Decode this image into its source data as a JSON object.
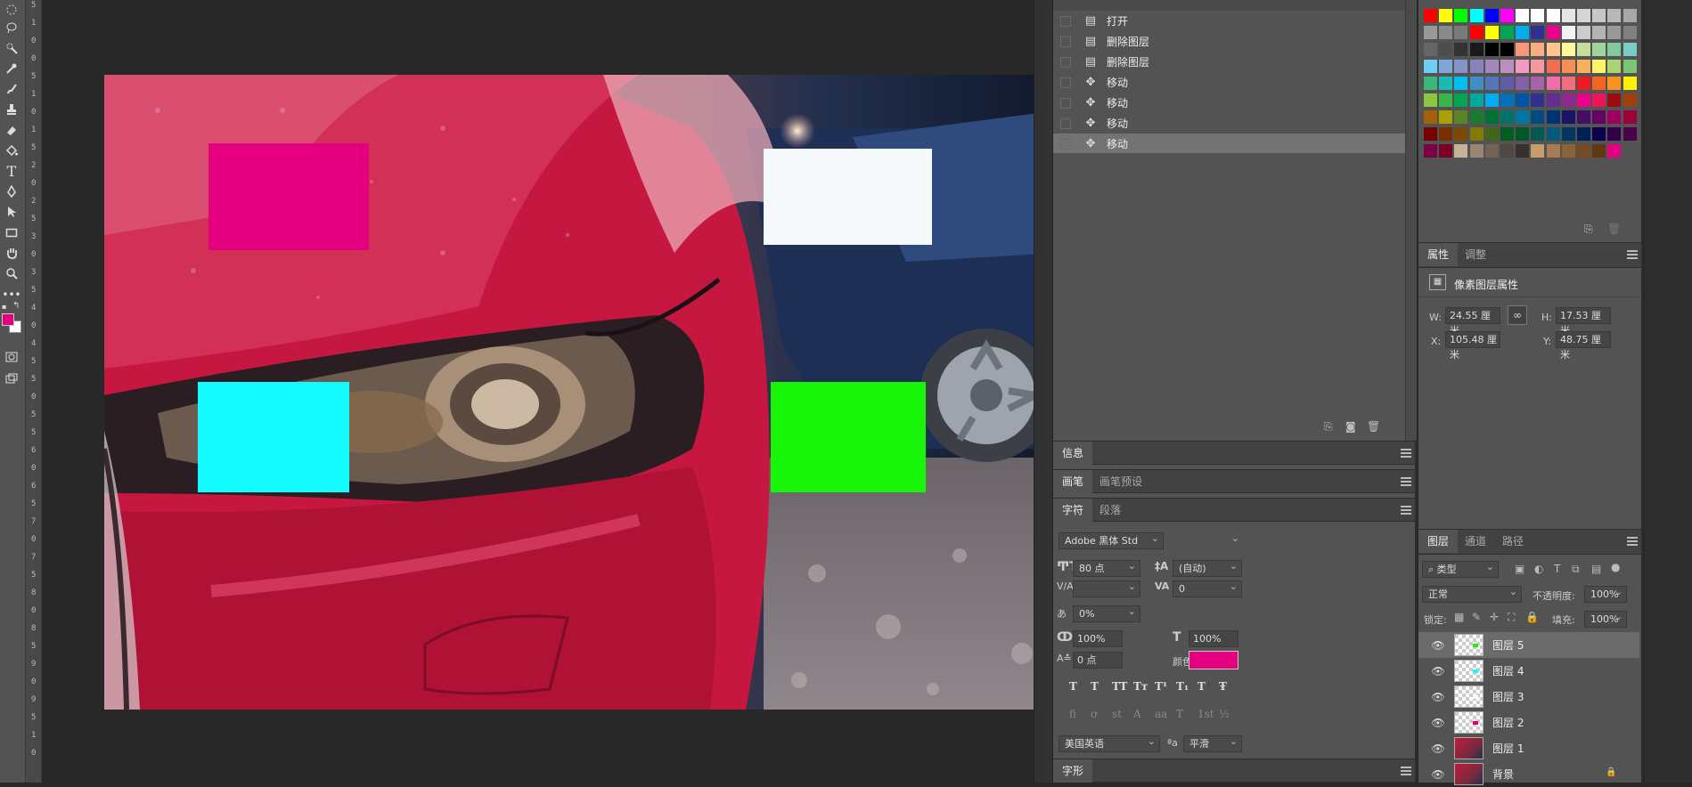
{
  "toolbar": {
    "tools": [
      "marquee-icon",
      "lasso-icon",
      "quick-select-icon",
      "eyedropper-icon",
      "brush-icon",
      "stamp-icon",
      "eraser-icon",
      "paint-bucket-icon",
      "type-icon",
      "pen-icon",
      "path-select-icon",
      "rectangle-icon",
      "hand-icon",
      "zoom-icon",
      "more-tools-icon"
    ],
    "type_glyph": "T",
    "foreground_color": "#e4007f",
    "background_color": "#ffffff"
  },
  "ruler_v": {
    "ticks": [
      "5",
      "1",
      "0",
      "0",
      "5",
      "1",
      "0",
      "1",
      "5",
      "2",
      "0",
      "2",
      "5",
      "3",
      "0",
      "3",
      "5",
      "4",
      "0",
      "4",
      "5",
      "5",
      "0",
      "5",
      "5",
      "6",
      "0",
      "6",
      "5",
      "7",
      "0",
      "7",
      "5",
      "8",
      "0",
      "8",
      "5",
      "9",
      "0",
      "9",
      "5",
      "1",
      "0"
    ]
  },
  "canvas": {
    "rects": [
      {
        "name": "magenta-rectangle",
        "color": "#e4007f"
      },
      {
        "name": "white-rectangle",
        "color": "#f6f9fb"
      },
      {
        "name": "cyan-rectangle",
        "color": "#14fbff"
      },
      {
        "name": "green-rectangle",
        "color": "#19f508"
      }
    ]
  },
  "history": {
    "items": [
      {
        "label": "打开",
        "icon": "document-icon"
      },
      {
        "label": "删除图层",
        "icon": "document-icon"
      },
      {
        "label": "删除图层",
        "icon": "document-icon"
      },
      {
        "label": "移动",
        "icon": "move-icon"
      },
      {
        "label": "移动",
        "icon": "move-icon"
      },
      {
        "label": "移动",
        "icon": "move-icon"
      },
      {
        "label": "移动",
        "icon": "move-icon"
      }
    ],
    "selected_index": 6
  },
  "info_panel": {
    "tab": "信息"
  },
  "brush_panel": {
    "tabs": [
      "画笔",
      "画笔预设"
    ]
  },
  "character_panel": {
    "tabs": [
      "字符",
      "段落"
    ],
    "font_family": "Adobe 黑体 Std",
    "font_size": "80 点",
    "leading": "(自动)",
    "kerning": "",
    "tracking": "0",
    "scale_label": "0%",
    "vertical_scale": "100%",
    "horizontal_scale": "100%",
    "baseline_shift": "0 点",
    "color_label": "颜色:",
    "color": "#e4007f",
    "language": "美国英语",
    "antialias": "平滑",
    "aa_label": "ªa",
    "style_buttons": [
      "T",
      "T",
      "TT",
      "Tт",
      "T¹",
      "T₁",
      "T",
      "Ŧ"
    ],
    "opentype_buttons": [
      "fi",
      "ơ",
      "st",
      "A",
      "aa",
      "T",
      "1st",
      "½"
    ]
  },
  "glyph_panel": {
    "tab": "字形"
  },
  "properties": {
    "tabs": [
      "属性",
      "调整"
    ],
    "title": "像素图层属性",
    "w_label": "W:",
    "w": "24.55 厘米",
    "h_label": "H:",
    "h": "17.53 厘米",
    "x_label": "X:",
    "x": "105.48 厘米",
    "y_label": "Y:",
    "y": "48.75 厘米"
  },
  "layers": {
    "tabs": [
      "图层",
      "通道",
      "路径"
    ],
    "filter": "类型",
    "blend_mode": "正常",
    "opacity_label": "不透明度:",
    "opacity": "100%",
    "lock_label": "锁定:",
    "fill_label": "填充:",
    "fill": "100%",
    "items": [
      {
        "name": "图层 5"
      },
      {
        "name": "图层 4"
      },
      {
        "name": "图层 3"
      },
      {
        "name": "图层 2"
      },
      {
        "name": "图层 1"
      },
      {
        "name": "背景"
      }
    ],
    "selected_index": 0
  },
  "swatches": {
    "rows": [
      [
        "#ff0000",
        "#ffff00",
        "#00ff00",
        "#00ffff",
        "#0000ff",
        "#ff00ff",
        "#ffffff",
        "#ffffff",
        "#ffffff",
        "#e6e6e6",
        "#d6d6d6",
        "#c7c7c7",
        "#b8b8b8",
        "#a8a8a8"
      ],
      [
        "#999999",
        "#8a8a8a",
        "#7a7a7a",
        "#ff0000",
        "#ffff00",
        "#00a651",
        "#00aeef",
        "#2e3192",
        "#ec008c",
        "#f2f2f2",
        "#cccccc",
        "#b3b3b3",
        "#999999",
        "#808080"
      ],
      [
        "#666666",
        "#4d4d4d",
        "#333333",
        "#1a1a1a",
        "#000000",
        "#000000",
        "#f7977a",
        "#f9ad81",
        "#fdc68a",
        "#fff79a",
        "#c4df9b",
        "#a3d39c",
        "#82ca9d",
        "#7bcdc8"
      ],
      [
        "#6ecff6",
        "#7ea7d8",
        "#8493ca",
        "#8882be",
        "#a187be",
        "#bc8dbf",
        "#f49ac2",
        "#f6989d",
        "#f26c4f",
        "#f68e55",
        "#fbaf5c",
        "#fff467",
        "#acd372",
        "#7cc576"
      ],
      [
        "#3bb878",
        "#1abbb4",
        "#00bff3",
        "#438cca",
        "#5574b9",
        "#605ca8",
        "#855fa8",
        "#a763a8",
        "#f06ea9",
        "#f26d7d",
        "#ed1c24",
        "#f26522",
        "#f7941d",
        "#fff200"
      ],
      [
        "#8dc73f",
        "#39b54a",
        "#00a651",
        "#00a99d",
        "#00aeef",
        "#0072bc",
        "#0054a6",
        "#2e3192",
        "#662d91",
        "#92278f",
        "#ec008c",
        "#ed145b",
        "#9e0b0f",
        "#a0410d"
      ],
      [
        "#a3620a",
        "#aba000",
        "#598527",
        "#1a7b30",
        "#007236",
        "#00746b",
        "#0076a3",
        "#004b80",
        "#003471",
        "#1b1464",
        "#440e62",
        "#630460",
        "#9e005d",
        "#9e0039"
      ],
      [
        "#790000",
        "#7b2e00",
        "#7d4900",
        "#827b00",
        "#406618",
        "#005e20",
        "#005826",
        "#005952",
        "#005b7f",
        "#003663",
        "#002157",
        "#0d004c",
        "#32004b",
        "#4b0049"
      ],
      [
        "#7b0046",
        "#7a0026",
        "#c7b299",
        "#998675",
        "#736357",
        "#534741",
        "#37302d",
        "#c69c6d",
        "#a67c52",
        "#8c6239",
        "#754c24",
        "#603913",
        "#e4007f"
      ]
    ]
  }
}
